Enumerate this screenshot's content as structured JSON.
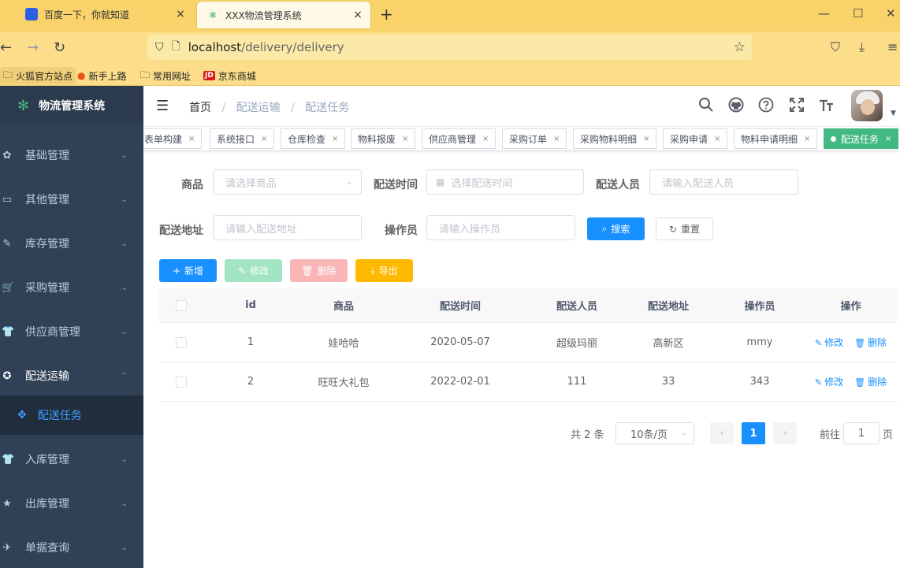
{
  "browser": {
    "tabs": [
      {
        "title": "百度一下，你就知道",
        "close": "×"
      },
      {
        "title": "XXX物流管理系统",
        "close": "×"
      }
    ],
    "new_tab": "+",
    "url_host": "localhost",
    "url_path": "/delivery/delivery",
    "bookmarks": [
      "火狐官方站点",
      "新手上路",
      "常用网址",
      "京东商城"
    ],
    "bookmark_jd_badge": "JD"
  },
  "sidebar": {
    "logo_text": "物流管理系统",
    "menus": [
      {
        "label": "基础管理",
        "icon": "gear-icon",
        "arrow": "⌄"
      },
      {
        "label": "其他管理",
        "icon": "briefcase-icon",
        "arrow": "⌄"
      },
      {
        "label": "库存管理",
        "icon": "edit-icon",
        "arrow": "⌄"
      },
      {
        "label": "采购管理",
        "icon": "cart-icon",
        "arrow": "⌄"
      },
      {
        "label": "供应商管理",
        "icon": "shirt-icon",
        "arrow": "⌄"
      },
      {
        "label": "配送运输",
        "icon": "compass-icon",
        "arrow": "⌃"
      },
      {
        "label": "入库管理",
        "icon": "shirt-icon",
        "arrow": "⌄"
      },
      {
        "label": "出库管理",
        "icon": "star-icon",
        "arrow": "⌄"
      },
      {
        "label": "单据查询",
        "icon": "plane-icon",
        "arrow": "⌄"
      }
    ],
    "active_submenu": "配送任务"
  },
  "header": {
    "breadcrumb": [
      "首页",
      "配送运输",
      "配送任务"
    ],
    "breadcrumb_sep": "/"
  },
  "tags": [
    "表单构建",
    "系统接口",
    "仓库检查",
    "物料报废",
    "供应商管理",
    "采购订单",
    "采购物料明细",
    "采购申请",
    "物料申请明细",
    "配送任务"
  ],
  "tag_close": "×",
  "search_form": {
    "goods_label": "商品",
    "goods_placeholder": "请选择商品",
    "time_label": "配送时间",
    "time_placeholder": "选择配送时间",
    "person_label": "配送人员",
    "person_placeholder": "请输入配送人员",
    "address_label": "配送地址",
    "address_placeholder": "请输入配送地址",
    "operator_label": "操作员",
    "operator_placeholder": "请输入操作员",
    "search_button": "搜索",
    "reset_button": "重置"
  },
  "toolbar": {
    "add": "新增",
    "edit": "修改",
    "delete": "删除",
    "export": "导出"
  },
  "table": {
    "columns": [
      "id",
      "商品",
      "配送时间",
      "配送人员",
      "配送地址",
      "操作员",
      "操作"
    ],
    "rows": [
      {
        "id": "1",
        "goods": "娃哈哈",
        "time": "2020-05-07",
        "person": "超级玛丽",
        "address": "高新区",
        "operator": "mmy",
        "edit": "修改",
        "delete": "删除"
      },
      {
        "id": "2",
        "goods": "旺旺大礼包",
        "time": "2022-02-01",
        "person": "111",
        "address": "33",
        "operator": "343",
        "edit": "修改",
        "delete": "删除"
      }
    ]
  },
  "pagination": {
    "total": "共 2 条",
    "page_size": "10条/页",
    "current_page": "1",
    "goto_prefix": "前往",
    "goto_value": "1",
    "goto_suffix": "页",
    "prev": "‹",
    "next": "›"
  },
  "colors": {
    "primary": "#1890ff",
    "sidebar_bg": "#304156",
    "active_tag": "#42b983",
    "browser_bar": "#f9d36a"
  }
}
